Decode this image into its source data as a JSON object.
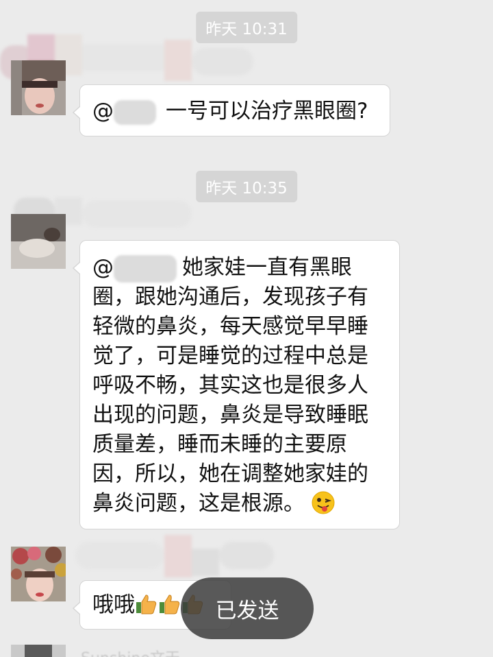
{
  "messages": [
    {
      "timestamp": "昨天 10:31",
      "mention_prefix": "@",
      "text": "一号可以治疗黑眼圈?"
    },
    {
      "timestamp": "昨天 10:35",
      "mention_prefix": "@",
      "lines": [
        "她家娃一直有黑眼",
        "圈，跟她沟通后，发现孩子有",
        "轻微的鼻炎，每天感觉早早睡",
        "觉了，可是睡觉的过程中总是",
        "呼吸不畅，其实这也是很多人",
        "出现的问题，鼻炎是导致睡眠",
        "质量差，睡而未睡的主要原",
        "因，所以，她在调整她家娃的",
        "鼻炎问题，这是根源。"
      ],
      "emoji": "winking-face-tongue"
    },
    {
      "text": "哦哦",
      "emoji": [
        "thumbs-up",
        "thumbs-up",
        "thumbs-up"
      ]
    }
  ],
  "toast": "已发送",
  "next_sender_partial": "Sunshine文天"
}
